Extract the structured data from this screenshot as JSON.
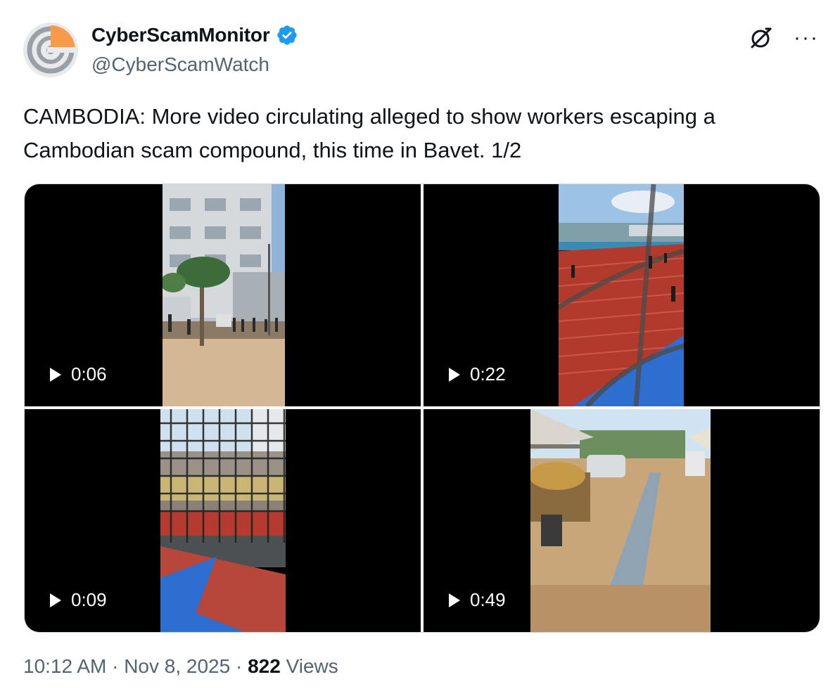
{
  "author": {
    "display_name": "CyberScamMonitor",
    "handle": "@CyberScamWatch",
    "verified": true
  },
  "tweet": {
    "text": "CAMBODIA: More video circulating alleged to show workers escaping a Cambodian scam compound, this time in Bavet. 1/2"
  },
  "media": [
    {
      "duration": "0:06"
    },
    {
      "duration": "0:22"
    },
    {
      "duration": "0:09"
    },
    {
      "duration": "0:49"
    }
  ],
  "footer": {
    "time": "10:12 AM",
    "separator": "·",
    "date": "Nov 8, 2025",
    "views_count": "822",
    "views_label": "Views"
  },
  "colors": {
    "text_primary": "#0f1419",
    "text_secondary": "#536471",
    "verified_blue": "#1d9bf0",
    "avatar_orange": "#f79b4a"
  },
  "icons": [
    "verified-badge-icon",
    "grok-icon",
    "more-icon",
    "play-icon"
  ]
}
